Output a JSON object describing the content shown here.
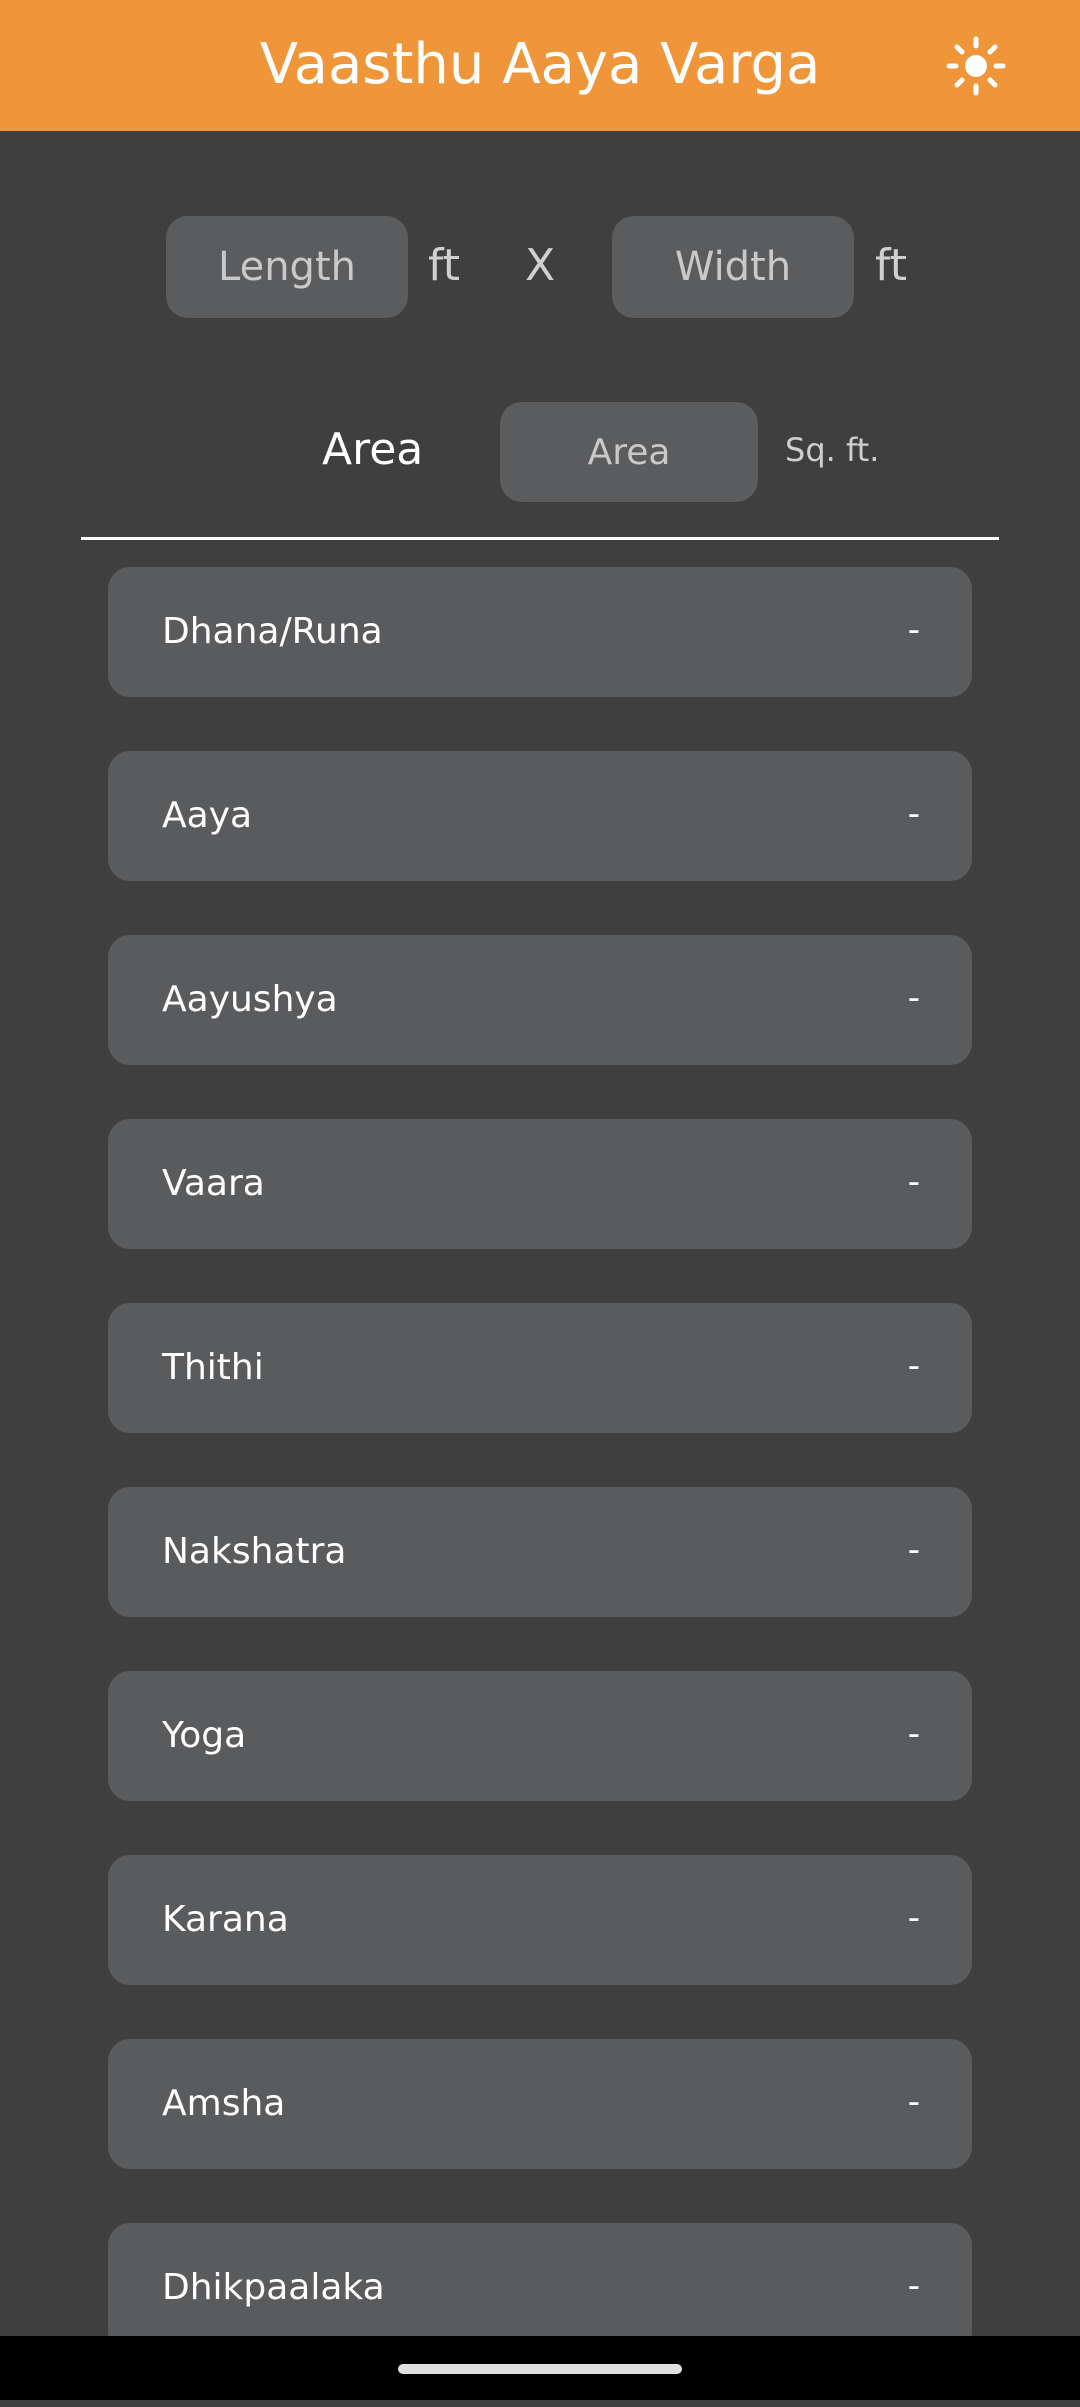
{
  "app": {
    "title": "Vaasthu Aaya Varga",
    "theme_icon": "sun-icon",
    "accent_color": "#f0963a"
  },
  "dimensions": {
    "length_placeholder": "Length",
    "length_unit": "ft",
    "times_symbol": "X",
    "width_placeholder": "Width",
    "width_unit": "ft"
  },
  "area": {
    "label": "Area",
    "placeholder": "Area",
    "unit": "Sq. ft."
  },
  "results": [
    {
      "label": "Dhana/Runa",
      "value": "-"
    },
    {
      "label": "Aaya",
      "value": "-"
    },
    {
      "label": "Aayushya",
      "value": "-"
    },
    {
      "label": "Vaara",
      "value": "-"
    },
    {
      "label": "Thithi",
      "value": "-"
    },
    {
      "label": "Nakshatra",
      "value": "-"
    },
    {
      "label": "Yoga",
      "value": "-"
    },
    {
      "label": "Karana",
      "value": "-"
    },
    {
      "label": "Amsha",
      "value": "-"
    },
    {
      "label": "Dhikpaalaka",
      "value": "-"
    }
  ]
}
